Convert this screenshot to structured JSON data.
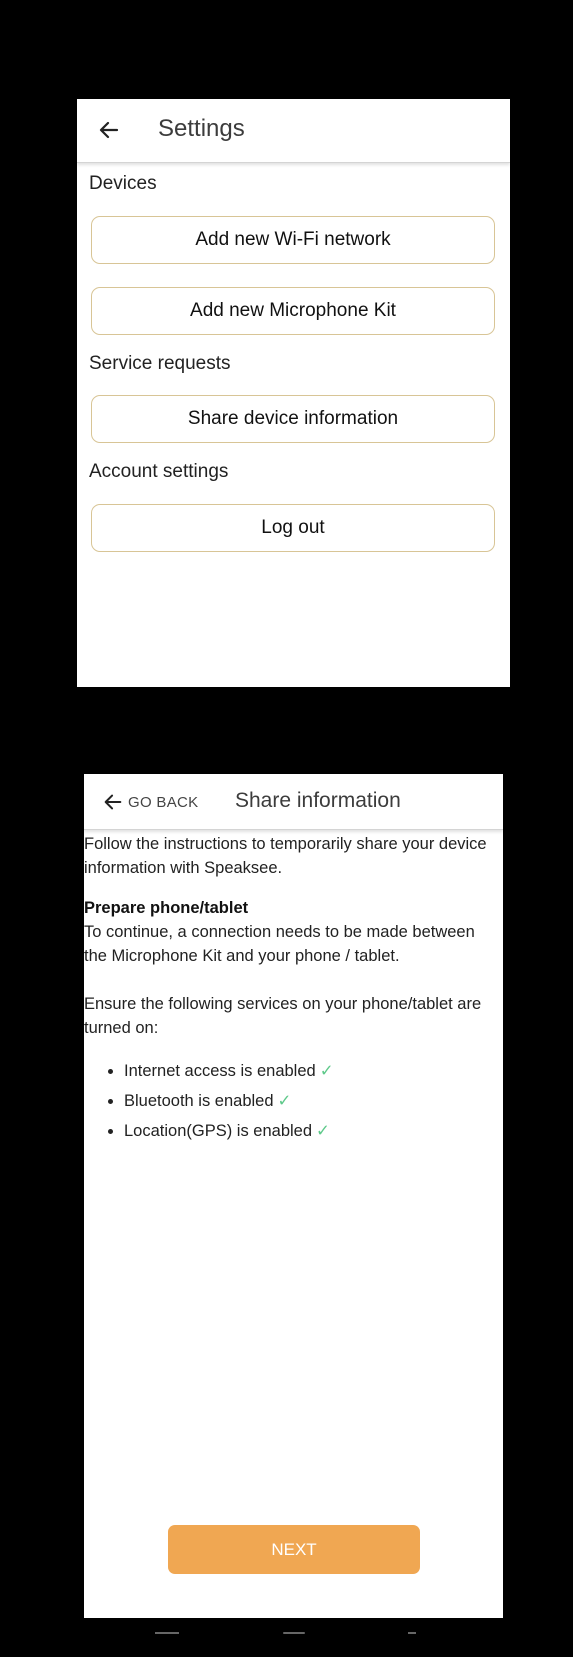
{
  "settings": {
    "title": "Settings",
    "sections": [
      {
        "label": "Devices"
      },
      {
        "label": "Service requests"
      },
      {
        "label": "Account settings"
      }
    ],
    "buttons": {
      "add_wifi": "Add new Wi-Fi network",
      "add_mic": "Add new Microphone Kit",
      "share_info": "Share device information",
      "logout": "Log out"
    },
    "button_border_color": "#d8c596"
  },
  "share": {
    "go_back": "GO BACK",
    "title": "Share information",
    "intro": "Follow the instructions to temporarily share your device information with Speaksee.",
    "prepare_heading": "Prepare phone/tablet",
    "prepare_text": "To continue, a connection needs to be made between the Microphone Kit and your phone / tablet.",
    "ensure_text": "Ensure the following services on your phone/tablet are turned on:",
    "services": [
      {
        "label": "Internet access is enabled",
        "check": "✓"
      },
      {
        "label": "Bluetooth is enabled",
        "check": "✓"
      },
      {
        "label": "Location(GPS) is enabled",
        "check": "✓"
      }
    ],
    "next_label": "NEXT",
    "accent_color": "#f0a752",
    "check_color": "#5ec98a"
  }
}
